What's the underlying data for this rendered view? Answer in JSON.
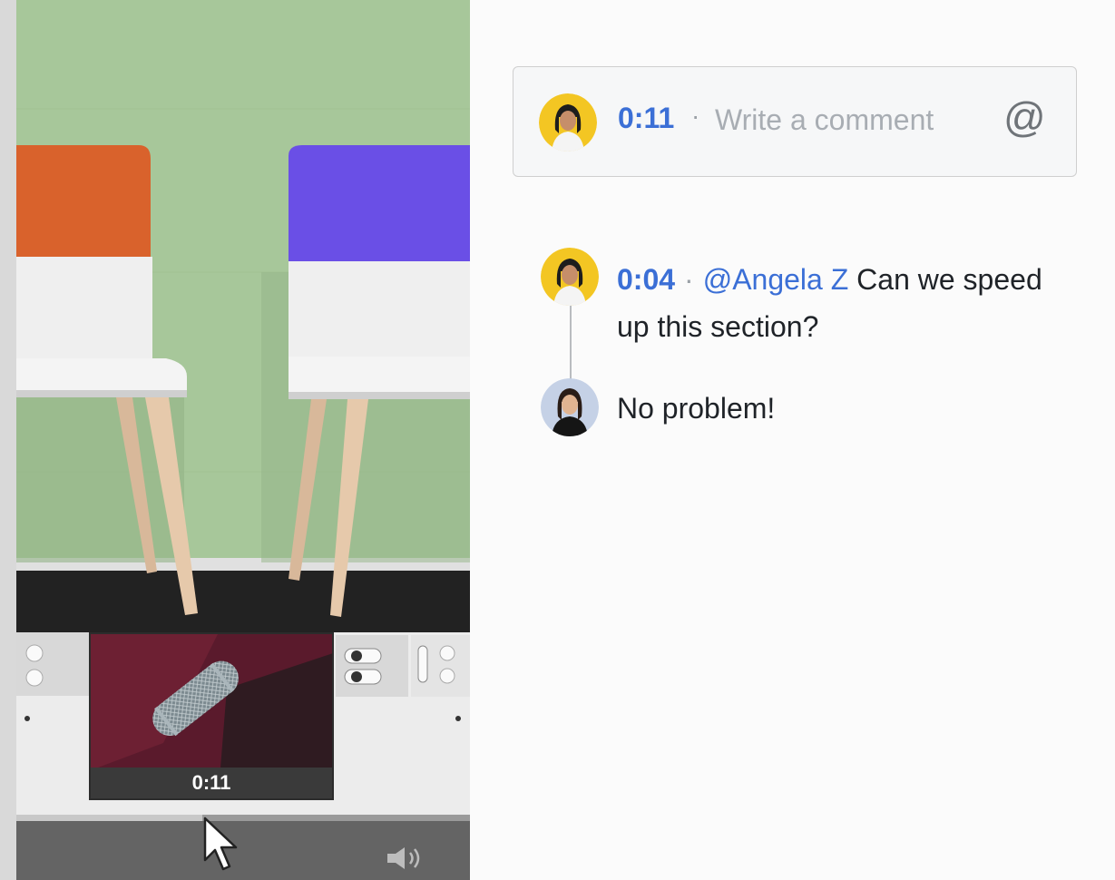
{
  "video": {
    "thumbnail_time": "0:11",
    "progress": 0.41
  },
  "icons": {
    "cursor": "arrow-cursor-icon",
    "volume": "volume-icon",
    "mention": "at-icon"
  },
  "comment_box": {
    "timestamp": "0:11",
    "separator": "·",
    "placeholder": "Write a comment",
    "mention_symbol": "@"
  },
  "thread": [
    {
      "timestamp": "0:04",
      "separator": "·",
      "mention": "@Angela Z",
      "text": "Can we speed up this section?"
    },
    {
      "text": "No problem!"
    }
  ],
  "colors": {
    "accent": "#3b6fd6",
    "chair_orange": "#d9622c",
    "chair_purple": "#6a4fe6",
    "wall": "#a7c79a",
    "avatar_yellow": "#f3c623",
    "avatar_blue": "#c5d1e6"
  }
}
